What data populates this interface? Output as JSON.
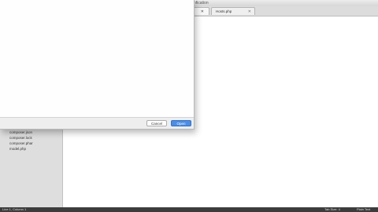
{
  "window": {
    "title_fragment": "nfication"
  },
  "tabs": [
    {
      "label": "",
      "close": "✕"
    },
    {
      "label": "Hosts.php",
      "close": "✕"
    }
  ],
  "sidebar": {
    "items": [
      {
        "label": "composer.json"
      },
      {
        "label": "composer.lock"
      },
      {
        "label": "composer.phar"
      },
      {
        "label": "model.php"
      }
    ]
  },
  "status": {
    "position": "Line 1, Column 1",
    "tab_size": "Tab Size: 4",
    "syntax": "Plain Text"
  },
  "dialog": {
    "cancel_label": "Cancel",
    "open_label": "Open"
  },
  "colors": {
    "accent": "#4a8ee8",
    "statusbar": "#3c3c3c",
    "sidebar": "#dedede"
  }
}
